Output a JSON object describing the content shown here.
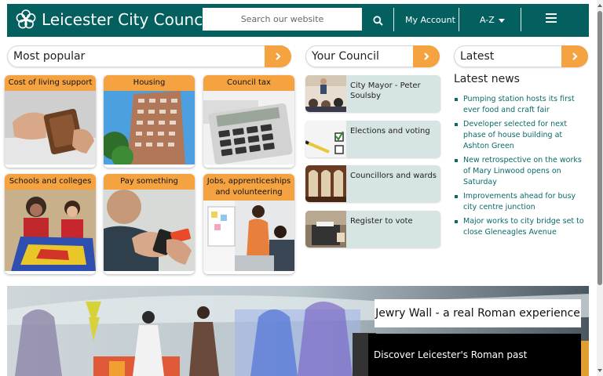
{
  "header": {
    "brand": "Leicester City Council",
    "search_placeholder": "Search our website",
    "my_account": "My Account",
    "az": "A-Z"
  },
  "sections": {
    "most_popular": "Most popular",
    "your_council": "Your Council",
    "latest": "Latest"
  },
  "popular": [
    {
      "label": "Cost of living support"
    },
    {
      "label": "Housing"
    },
    {
      "label": "Council tax"
    },
    {
      "label": "Schools and colleges"
    },
    {
      "label": "Pay something"
    },
    {
      "label": "Jobs, apprenticeships and volunteering"
    }
  ],
  "council": [
    {
      "label": "City Mayor - Peter Soulsby"
    },
    {
      "label": "Elections and voting"
    },
    {
      "label": "Councillors and wards"
    },
    {
      "label": "Register to vote"
    }
  ],
  "news": {
    "title": "Latest news",
    "items": [
      "Pumping station hosts its first ever food and craft fair",
      "Developer selected for next phase of house building at Ashton Green",
      "New retrospective on the works of Mary Linwood opens on Saturday",
      "Improvements ahead for busy city centre junction",
      "Major works to city bridge set to close Gleneagles Avenue"
    ]
  },
  "banner": {
    "title": "Jewry Wall - a real Roman experience",
    "subtitle": "Discover Leicester's Roman past"
  },
  "colors": {
    "header": "#045f5f",
    "accent": "#f4a340",
    "council_tile": "#d7e4e4",
    "link": "#0a6a6a"
  }
}
